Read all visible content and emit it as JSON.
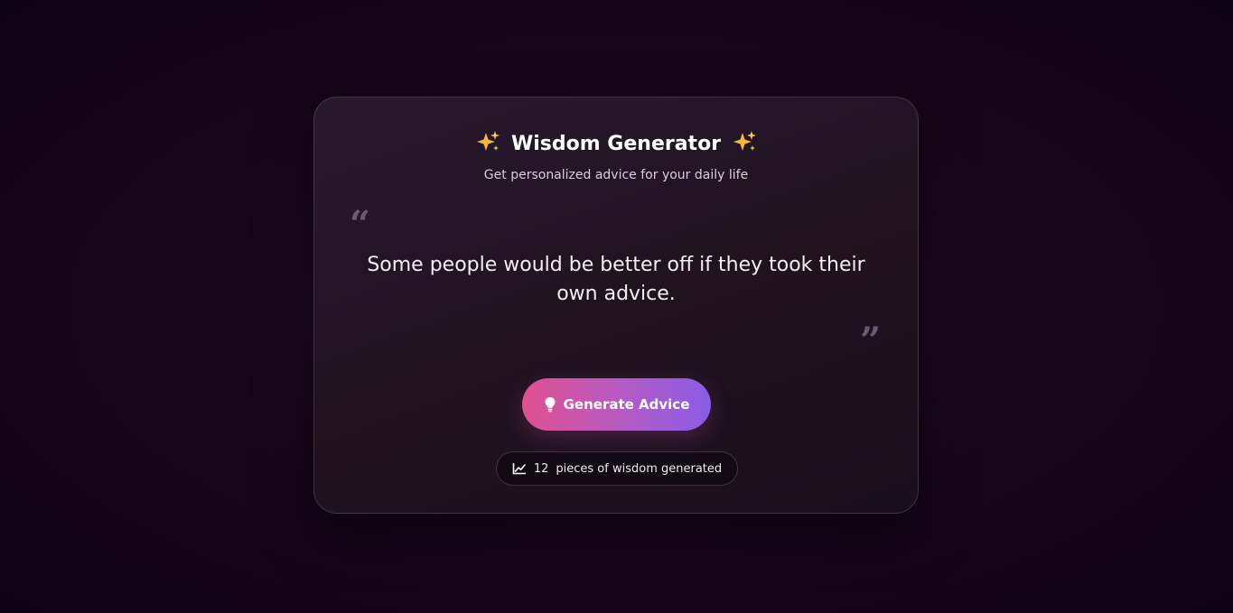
{
  "card": {
    "title": "Wisdom Generator",
    "title_icon_left": "sparkles-icon",
    "title_icon_right": "sparkles-icon",
    "subtitle": "Get personalized advice for your daily life",
    "quote_open": "“",
    "quote_close": "”",
    "advice_text": "Some people would be better off if they took their own advice.",
    "generate_button": {
      "label": "Generate Advice",
      "icon": "lightbulb-icon"
    },
    "counter": {
      "icon": "chart-line-icon",
      "count": "12",
      "suffix": "pieces of wisdom generated"
    }
  },
  "colors": {
    "background": "#160519",
    "card": "#231526",
    "button_start": "#e0508f",
    "button_end": "#8a5ce6",
    "quote_mark": "#6b5a70"
  }
}
